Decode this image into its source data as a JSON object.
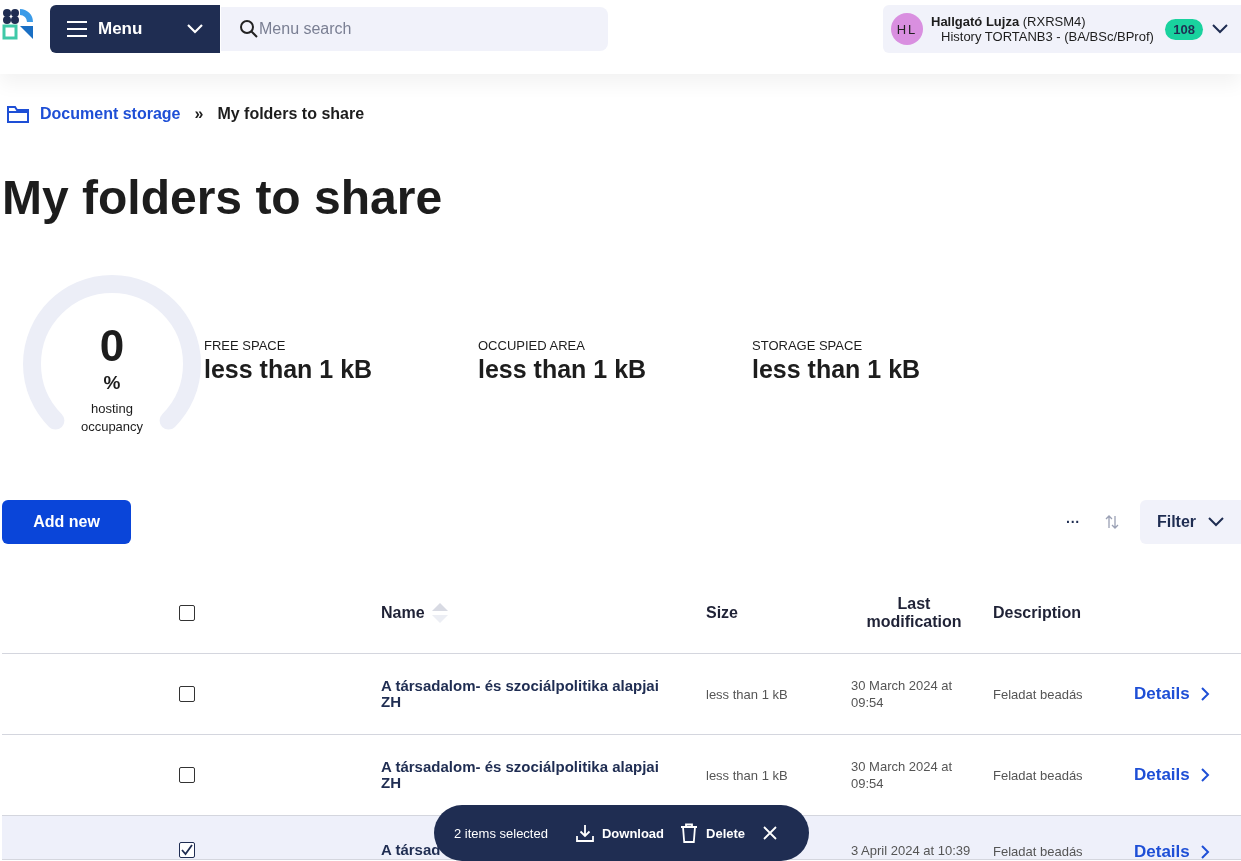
{
  "header": {
    "menu_button": "Menu",
    "search": {
      "placeholder": "Menu search"
    },
    "user": {
      "initials": "HL",
      "name": "Hallgató Lujza",
      "code": "(RXRSM4)",
      "program": "History TORTANB3 - (BA/BSc/BProf)",
      "badge": "108"
    }
  },
  "breadcrumb": [
    {
      "label": "Document storage",
      "kind": "link"
    },
    {
      "label": "My folders to share",
      "kind": "current"
    }
  ],
  "breadcrumb_separator": "»",
  "title": "My folders to share",
  "gauge": {
    "value": "0",
    "unit": "%",
    "label": "hosting occupancy"
  },
  "stats": [
    {
      "label": "FREE SPACE",
      "value": "less than 1 kB"
    },
    {
      "label": "OCCUPIED AREA",
      "value": "less than 1 kB"
    },
    {
      "label": "STORAGE SPACE",
      "value": "less than 1 kB"
    }
  ],
  "toolbar": {
    "add_button": "Add new",
    "more": "···",
    "filter": "Filter"
  },
  "table": {
    "select_all_checked": false,
    "columns": [
      "Name",
      "Size",
      "Last modification",
      "Description"
    ],
    "rows": [
      {
        "selected": false,
        "name": "A társadalom- és szociálpolitika alapjai ZH",
        "size": "less than 1 kB",
        "modified": "30 March 2024 at 09:54",
        "description": "Feladat beadás",
        "action": "Details"
      },
      {
        "selected": false,
        "name": "A társadalom- és szociálpolitika alapjai ZH",
        "size": "less than 1 kB",
        "modified": "30 March 2024 at 09:54",
        "description": "Feladat beadás",
        "action": "Details"
      },
      {
        "selected": true,
        "name": "A társad",
        "modified": "3 April 2024 at 10:39",
        "description": "Feladat beadás",
        "action": "Details"
      }
    ]
  },
  "selection_bar": {
    "count": "2 items selected",
    "download": "Download",
    "delete": "Delete"
  }
}
